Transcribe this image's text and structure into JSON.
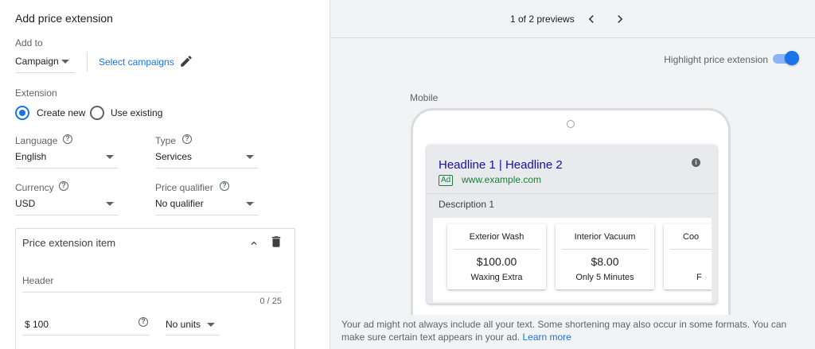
{
  "panel": {
    "title": "Add price extension",
    "add_to_label": "Add to",
    "add_to_value": "Campaign",
    "select_campaigns": "Select campaigns",
    "extension_label": "Extension",
    "create_new": "Create new",
    "use_existing": "Use existing",
    "language_label": "Language",
    "language_value": "English",
    "type_label": "Type",
    "type_value": "Services",
    "currency_label": "Currency",
    "currency_value": "USD",
    "qualifier_label": "Price qualifier",
    "qualifier_value": "No qualifier",
    "help_glyph": "?"
  },
  "item_card": {
    "title": "Price extension item",
    "header_placeholder": "Header",
    "char_count": "0 / 25",
    "price_value": "$ 100",
    "units_value": "No units"
  },
  "preview": {
    "counter": "1 of 2 previews",
    "highlight_label": "Highlight price extension",
    "highlight_on": true,
    "device_label": "Mobile",
    "headline": "Headline 1 | Headline 2",
    "ad_badge": "Ad",
    "url": "www.example.com",
    "info_glyph": "i",
    "description": "Description 1",
    "items": [
      {
        "header": "Exterior Wash",
        "price": "$100.00",
        "description": "Waxing Extra"
      },
      {
        "header": "Interior Vacuum",
        "price": "$8.00",
        "description": "Only 5 Minutes"
      },
      {
        "header": "Coo",
        "price": "",
        "description": "F"
      }
    ],
    "disclaimer": "Your ad might not always include all your text. Some shortening may also occur in some formats. You can make sure certain text appears in your ad.",
    "learn_more": "Learn more"
  },
  "colors": {
    "accent": "#1a73e8",
    "headline": "#1a0dab",
    "url_green": "#188038",
    "pane_bg": "#f1f3f4"
  }
}
